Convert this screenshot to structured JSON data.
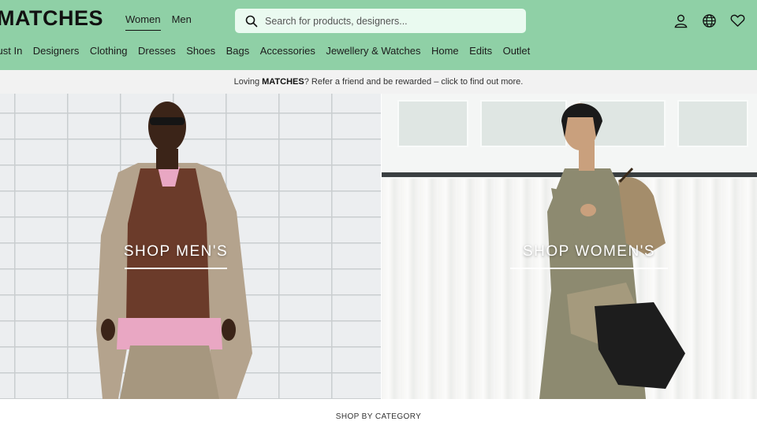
{
  "brand": {
    "logo_text": "MATCHES"
  },
  "gender_tabs": [
    {
      "label": "Women",
      "active": true
    },
    {
      "label": "Men",
      "active": false
    }
  ],
  "search": {
    "placeholder": "Search for products, designers..."
  },
  "header_icons": [
    "account-icon",
    "globe-icon",
    "wishlist-heart-icon"
  ],
  "nav": {
    "items": [
      "Just In",
      "Designers",
      "Clothing",
      "Dresses",
      "Shoes",
      "Bags",
      "Accessories",
      "Jewellery & Watches",
      "Home",
      "Edits",
      "Outlet"
    ]
  },
  "promo": {
    "prefix": "Loving ",
    "brand": "MATCHES",
    "suffix": "? Refer a friend and be rewarded – click to find out more."
  },
  "hero": {
    "men_cta": "SHOP MEN'S",
    "women_cta": "SHOP WOMEN'S"
  },
  "section": {
    "category_title": "SHOP BY CATEGORY"
  },
  "colors": {
    "header_bg": "#8fd0a6",
    "search_bg": "#eafaf0",
    "promo_bg": "#f2f2f2"
  }
}
